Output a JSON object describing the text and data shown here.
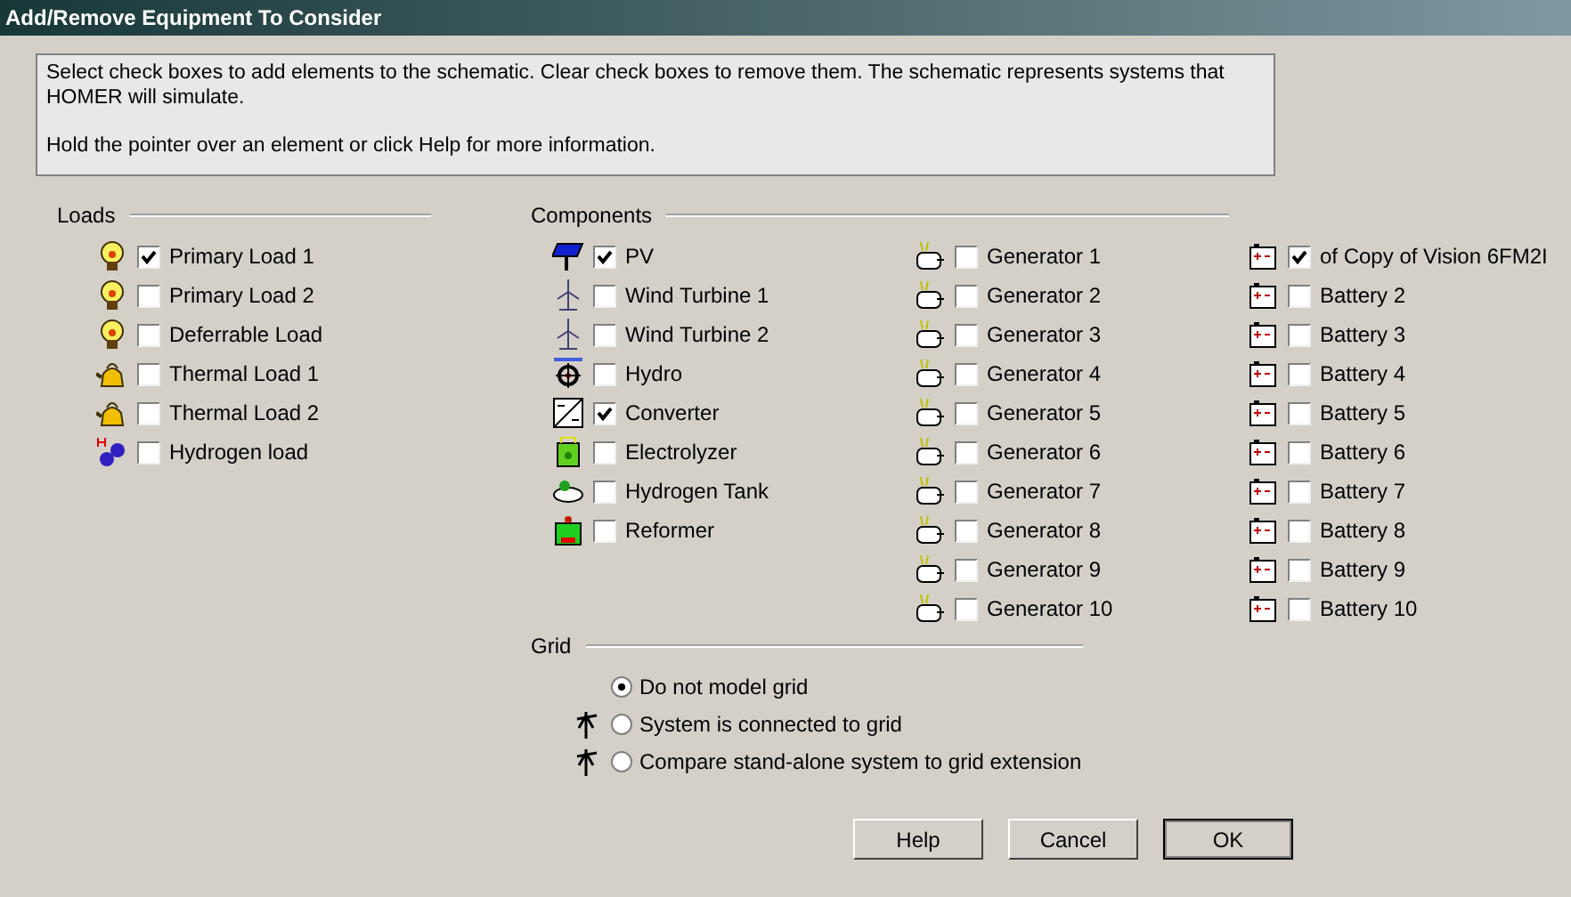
{
  "window": {
    "title": "Add/Remove Equipment To Consider"
  },
  "info": {
    "lines": [
      "Select check boxes to add elements to the schematic. Clear check boxes to remove them. The schematic represents systems that HOMER will simulate.",
      "Hold the pointer over an element or click Help for more information."
    ]
  },
  "loads": {
    "heading": "Loads",
    "items": [
      {
        "label": "Primary Load 1",
        "kind": "bulb",
        "checked": true
      },
      {
        "label": "Primary Load 2",
        "kind": "bulb",
        "checked": false
      },
      {
        "label": "Deferrable Load",
        "kind": "bulb",
        "checked": false
      },
      {
        "label": "Thermal Load 1",
        "kind": "kettle",
        "checked": false
      },
      {
        "label": "Thermal Load 2",
        "kind": "kettle",
        "checked": false
      },
      {
        "label": "Hydrogen load",
        "kind": "hydrogen",
        "checked": false
      }
    ]
  },
  "components": {
    "heading": "Components",
    "columns": [
      [
        {
          "label": "PV",
          "kind": "solar",
          "checked": true
        },
        {
          "label": "Wind Turbine 1",
          "kind": "wind",
          "checked": false
        },
        {
          "label": "Wind Turbine 2",
          "kind": "wind",
          "checked": false
        },
        {
          "label": "Hydro",
          "kind": "hydro",
          "checked": false
        },
        {
          "label": "Converter",
          "kind": "converter",
          "checked": true
        },
        {
          "label": "Electrolyzer",
          "kind": "electrolyzer",
          "checked": false
        },
        {
          "label": "Hydrogen Tank",
          "kind": "tank",
          "checked": false
        },
        {
          "label": "Reformer",
          "kind": "reformer",
          "checked": false
        }
      ],
      [
        {
          "label": "Generator 1",
          "kind": "generator",
          "checked": false
        },
        {
          "label": "Generator 2",
          "kind": "generator",
          "checked": false
        },
        {
          "label": "Generator 3",
          "kind": "generator",
          "checked": false
        },
        {
          "label": "Generator 4",
          "kind": "generator",
          "checked": false
        },
        {
          "label": "Generator 5",
          "kind": "generator",
          "checked": false
        },
        {
          "label": "Generator 6",
          "kind": "generator",
          "checked": false
        },
        {
          "label": "Generator 7",
          "kind": "generator",
          "checked": false
        },
        {
          "label": "Generator 8",
          "kind": "generator",
          "checked": false
        },
        {
          "label": "Generator 9",
          "kind": "generator",
          "checked": false
        },
        {
          "label": "Generator 10",
          "kind": "generator",
          "checked": false
        }
      ],
      [
        {
          "label": "of Copy of Vision 6FM2I",
          "kind": "battery",
          "checked": true
        },
        {
          "label": "Battery 2",
          "kind": "battery",
          "checked": false
        },
        {
          "label": "Battery 3",
          "kind": "battery",
          "checked": false
        },
        {
          "label": "Battery 4",
          "kind": "battery",
          "checked": false
        },
        {
          "label": "Battery 5",
          "kind": "battery",
          "checked": false
        },
        {
          "label": "Battery 6",
          "kind": "battery",
          "checked": false
        },
        {
          "label": "Battery 7",
          "kind": "battery",
          "checked": false
        },
        {
          "label": "Battery 8",
          "kind": "battery",
          "checked": false
        },
        {
          "label": "Battery 9",
          "kind": "battery",
          "checked": false
        },
        {
          "label": "Battery 10",
          "kind": "battery",
          "checked": false
        }
      ]
    ]
  },
  "grid": {
    "heading": "Grid",
    "options": [
      {
        "label": "Do not model grid",
        "kind": "plain",
        "selected": true
      },
      {
        "label": "System is connected to grid",
        "kind": "tower",
        "selected": false
      },
      {
        "label": "Compare stand-alone system to grid extension",
        "kind": "tower",
        "selected": false
      }
    ]
  },
  "buttons": [
    {
      "label": "Help",
      "default": false
    },
    {
      "label": "Cancel",
      "default": false
    },
    {
      "label": "OK",
      "default": true
    }
  ]
}
